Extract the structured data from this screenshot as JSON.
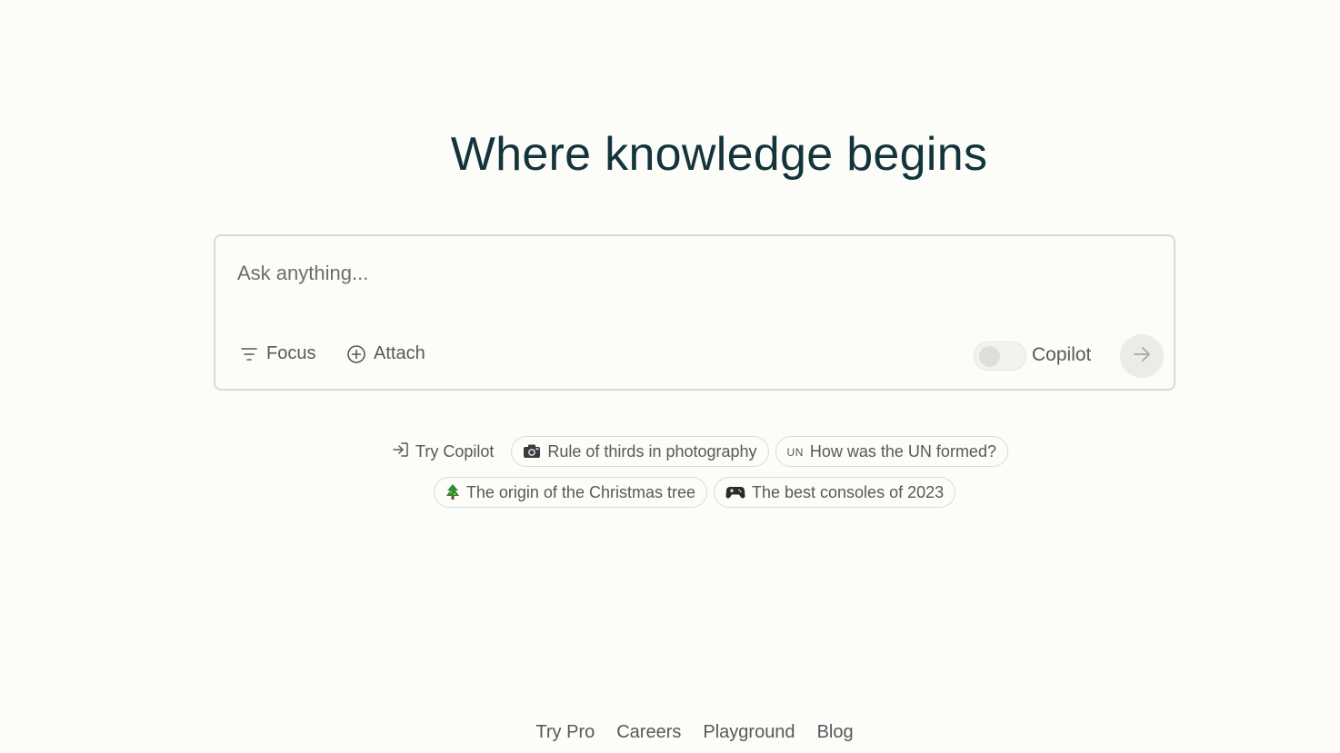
{
  "headline": "Where knowledge begins",
  "search": {
    "placeholder": "Ask anything...",
    "value": "",
    "focus_label": "Focus",
    "attach_label": "Attach",
    "copilot_label": "Copilot",
    "copilot_enabled": false
  },
  "suggestions": {
    "try_copilot_label": "Try Copilot",
    "items": [
      {
        "icon": "camera-icon",
        "label": "Rule of thirds in photography"
      },
      {
        "icon": "un-icon",
        "icon_text": "UN",
        "label": "How was the UN formed?"
      },
      {
        "icon": "christmas-tree-icon",
        "label": "The origin of the Christmas tree"
      },
      {
        "icon": "game-controller-icon",
        "label": "The best consoles of 2023"
      }
    ]
  },
  "footer": {
    "links": [
      "Try Pro",
      "Careers",
      "Playground",
      "Blog"
    ]
  },
  "colors": {
    "background": "#fcfcf9",
    "headline": "#13343b",
    "muted_text": "#56595a",
    "border": "#d9dad5"
  }
}
